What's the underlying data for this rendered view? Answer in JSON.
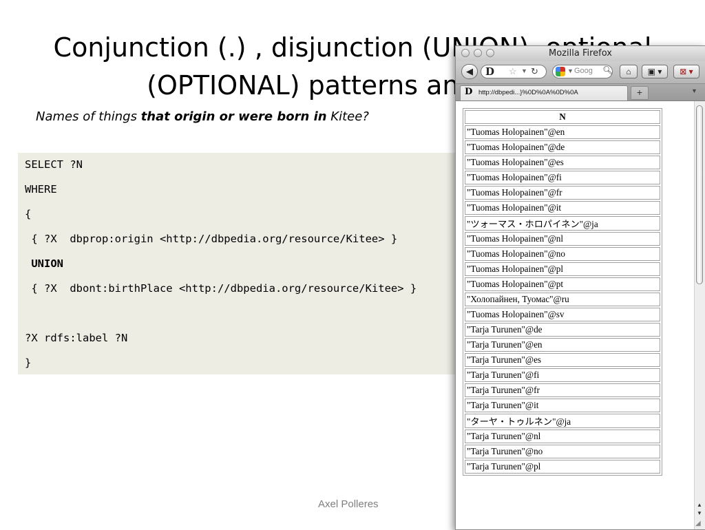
{
  "slide": {
    "title": "Conjunction (.) , disjunction (UNION), optional\n(OPTIONAL) patterns and filters",
    "subtitle_parts": [
      "Names of things ",
      "that origin or were born in",
      " Kitee",
      "?"
    ],
    "code_lines": [
      "SELECT ?N",
      "WHERE",
      "{",
      " { ?X  dbprop:origin <http://dbpedia.org/resource/Kitee> }",
      " UNION",
      " { ?X  dbont:birthPlace <http://dbpedia.org/resource/Kitee> }",
      "?X rdfs:label ?N",
      "}"
    ],
    "footer": "Axel Polleres"
  },
  "browser": {
    "window_title": "Mozilla Firefox",
    "favicon_letter": "D",
    "search_placeholder": "Goog",
    "tab_label": "http://dbpedi...}%0D%0A%0D%0A",
    "new_tab": "+",
    "icons": [
      "back-arrow-icon",
      "bookmark-star-icon",
      "reload-icon",
      "google-icon",
      "search-icon",
      "home-icon",
      "bookmarks-icon",
      "addon-icon",
      "tab-list-icon"
    ]
  },
  "results": {
    "header": "N",
    "rows": [
      "\"Tuomas Holopainen\"@en",
      "\"Tuomas Holopainen\"@de",
      "\"Tuomas Holopainen\"@es",
      "\"Tuomas Holopainen\"@fi",
      "\"Tuomas Holopainen\"@fr",
      "\"Tuomas Holopainen\"@it",
      "\"ツォーマス・ホロパイネン\"@ja",
      "\"Tuomas Holopainen\"@nl",
      "\"Tuomas Holopainen\"@no",
      "\"Tuomas Holopainen\"@pl",
      "\"Tuomas Holopainen\"@pt",
      "\"Холопайнен, Туомас\"@ru",
      "\"Tuomas Holopainen\"@sv",
      "\"Tarja Turunen\"@de",
      "\"Tarja Turunen\"@en",
      "\"Tarja Turunen\"@es",
      "\"Tarja Turunen\"@fi",
      "\"Tarja Turunen\"@fr",
      "\"Tarja Turunen\"@it",
      "\"ターヤ・トゥルネン\"@ja",
      "\"Tarja Turunen\"@nl",
      "\"Tarja Turunen\"@no",
      "\"Tarja Turunen\"@pl"
    ]
  }
}
